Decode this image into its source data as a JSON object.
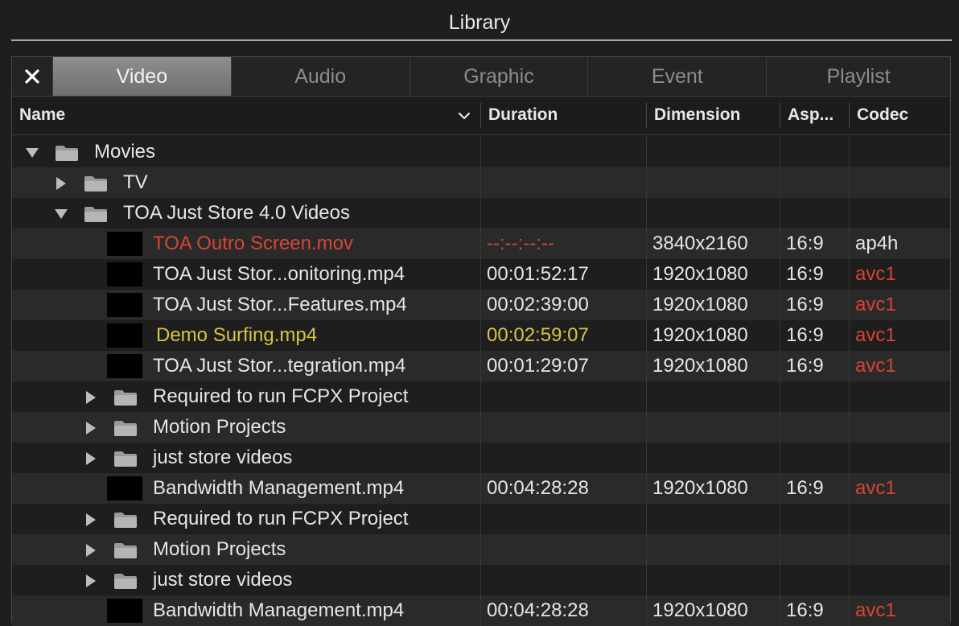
{
  "window": {
    "title": "Library"
  },
  "tabs": {
    "close_icon": "close-icon",
    "items": [
      "Video",
      "Audio",
      "Graphic",
      "Event",
      "Playlist"
    ],
    "active": "Video"
  },
  "columns": {
    "name": "Name",
    "duration": "Duration",
    "dimension": "Dimension",
    "aspect": "Asp...",
    "codec": "Codec"
  },
  "rows": [
    {
      "kind": "folder",
      "depth": 0,
      "expanded": true,
      "name": "Movies"
    },
    {
      "kind": "folder",
      "depth": 1,
      "expanded": false,
      "name": "TV"
    },
    {
      "kind": "folder",
      "depth": 1,
      "expanded": true,
      "name": "TOA Just Store 4.0 Videos"
    },
    {
      "kind": "file",
      "name": "TOA Outro Screen.mov",
      "duration": "--:--:--:--",
      "dimension": "3840x2160",
      "aspect": "16:9",
      "codec": "ap4h",
      "name_color": "#d64533",
      "duration_color": "#d64533",
      "codec_color": "#e6e6e6"
    },
    {
      "kind": "file",
      "name": "TOA Just Stor...onitoring.mp4",
      "duration": "00:01:52:17",
      "dimension": "1920x1080",
      "aspect": "16:9",
      "codec": "avc1",
      "codec_color": "#d64533"
    },
    {
      "kind": "file",
      "name": "TOA Just Stor...Features.mp4",
      "duration": "00:02:39:00",
      "dimension": "1920x1080",
      "aspect": "16:9",
      "codec": "avc1",
      "codec_color": "#d64533"
    },
    {
      "kind": "file",
      "name": "Demo Surfing.mp4",
      "duration": "00:02:59:07",
      "dimension": "1920x1080",
      "aspect": "16:9",
      "codec": "avc1",
      "name_color": "#d9c340",
      "duration_color": "#d9c340",
      "codec_color": "#d64533"
    },
    {
      "kind": "file",
      "name": "TOA Just Stor...tegration.mp4",
      "duration": "00:01:29:07",
      "dimension": "1920x1080",
      "aspect": "16:9",
      "codec": "avc1",
      "codec_color": "#d64533"
    },
    {
      "kind": "folder",
      "depth": 2,
      "expanded": false,
      "name": "Required to run FCPX Project"
    },
    {
      "kind": "folder",
      "depth": 2,
      "expanded": false,
      "name": "Motion Projects"
    },
    {
      "kind": "folder",
      "depth": 2,
      "expanded": false,
      "name": "just store videos"
    },
    {
      "kind": "file",
      "name": "Bandwidth Management.mp4",
      "duration": "00:04:28:28",
      "dimension": "1920x1080",
      "aspect": "16:9",
      "codec": "avc1",
      "codec_color": "#d64533"
    },
    {
      "kind": "folder",
      "depth": 2,
      "expanded": false,
      "name": "Required to run FCPX Project"
    },
    {
      "kind": "folder",
      "depth": 2,
      "expanded": false,
      "name": "Motion Projects"
    },
    {
      "kind": "folder",
      "depth": 2,
      "expanded": false,
      "name": "just store videos"
    },
    {
      "kind": "file",
      "name": "Bandwidth Management.mp4",
      "duration": "00:04:28:28",
      "dimension": "1920x1080",
      "aspect": "16:9",
      "codec": "avc1",
      "codec_color": "#d64533"
    }
  ]
}
